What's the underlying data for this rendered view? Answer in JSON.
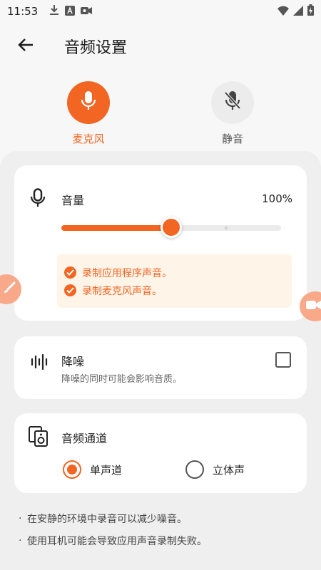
{
  "status_bar": {
    "time": "11:53"
  },
  "header": {
    "title": "音频设置"
  },
  "modes": [
    {
      "label": "麦克风",
      "selected": true
    },
    {
      "label": "静音",
      "selected": false
    }
  ],
  "volume": {
    "label": "音量",
    "value_text": "100%",
    "slider_fraction": 0.5,
    "notices": [
      "录制应用程序声音。",
      "录制麦克风声音。"
    ]
  },
  "noise": {
    "label": "降噪",
    "description": "降噪的同时可能会影响音质。",
    "checked": false
  },
  "channel": {
    "label": "音频通道",
    "options": [
      {
        "label": "单声道",
        "selected": true
      },
      {
        "label": "立体声",
        "selected": false
      }
    ]
  },
  "tips": [
    "在安静的环境中录音可以减少噪音。",
    "使用耳机可能会导致应用声音录制失败。"
  ],
  "colors": {
    "accent": "#f26522",
    "accent_light": "#fff4e8",
    "float_button": "#f8a98a"
  }
}
